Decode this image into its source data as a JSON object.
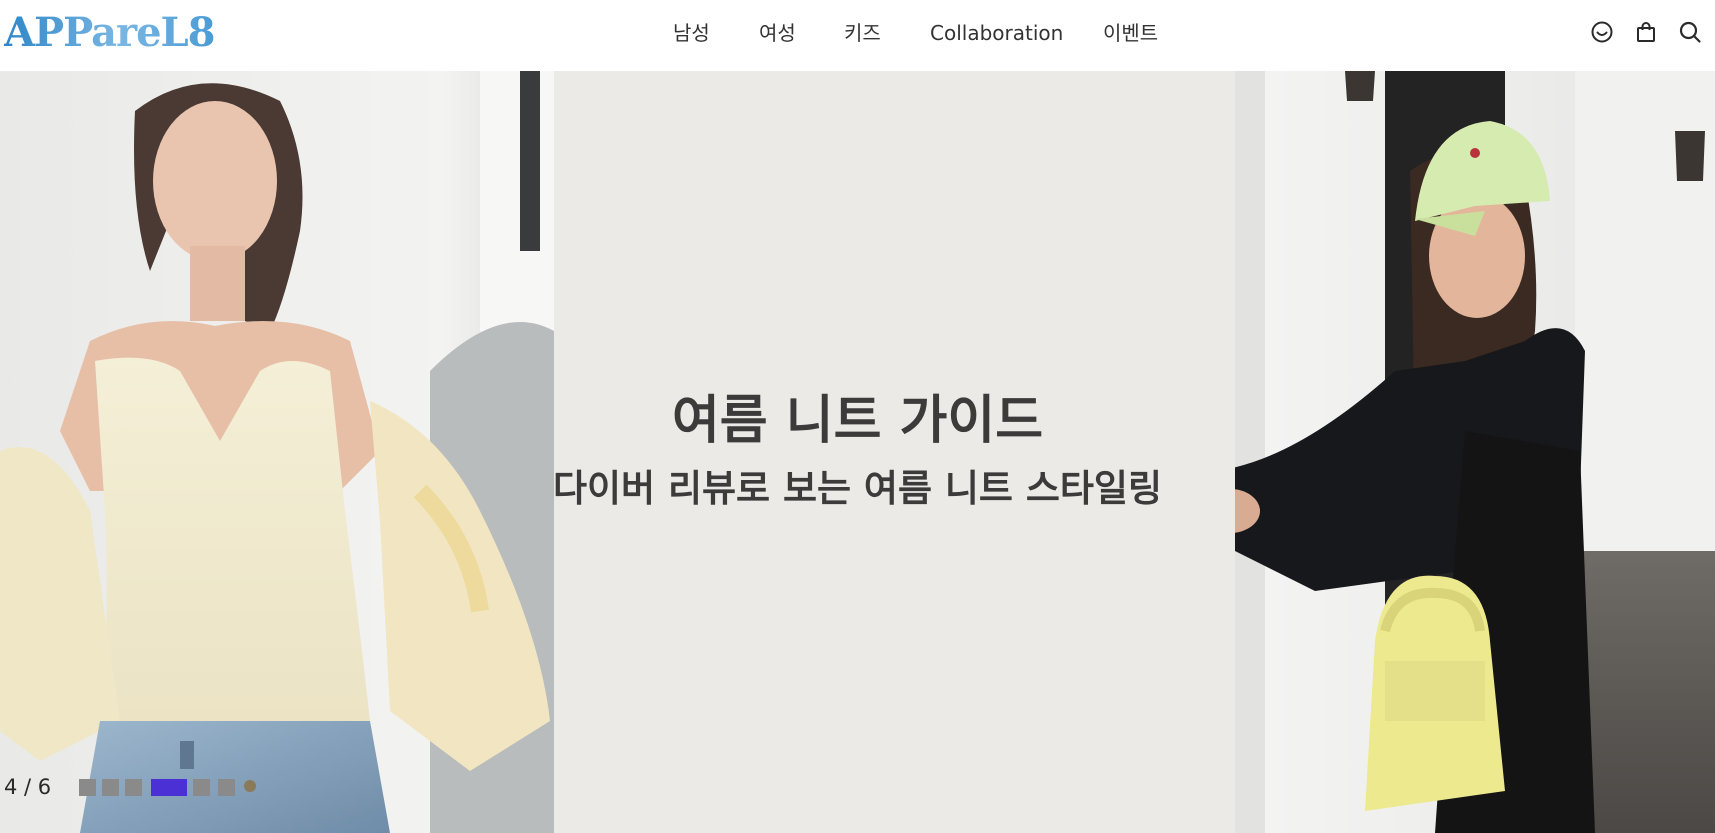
{
  "header": {
    "logo_text": "APPareL8",
    "nav": [
      "남성",
      "여성",
      "키즈",
      "Collaboration",
      "이벤트"
    ],
    "icons": [
      "smile-icon",
      "shopping-bag-icon",
      "search-icon"
    ]
  },
  "hero": {
    "title": "여름 니트 가이드",
    "subtitle": "다이버 리뷰로 보는 여름 니트 스타일링",
    "counter": "4 / 6",
    "current_slide": 4,
    "total_slides": 6
  },
  "colors": {
    "logo": "#3b8fd1",
    "hero_background": "#eceae7",
    "hero_text": "#3d3b3a",
    "active_dot": "#4b30d6",
    "inactive_dot": "#8a8a8a"
  }
}
